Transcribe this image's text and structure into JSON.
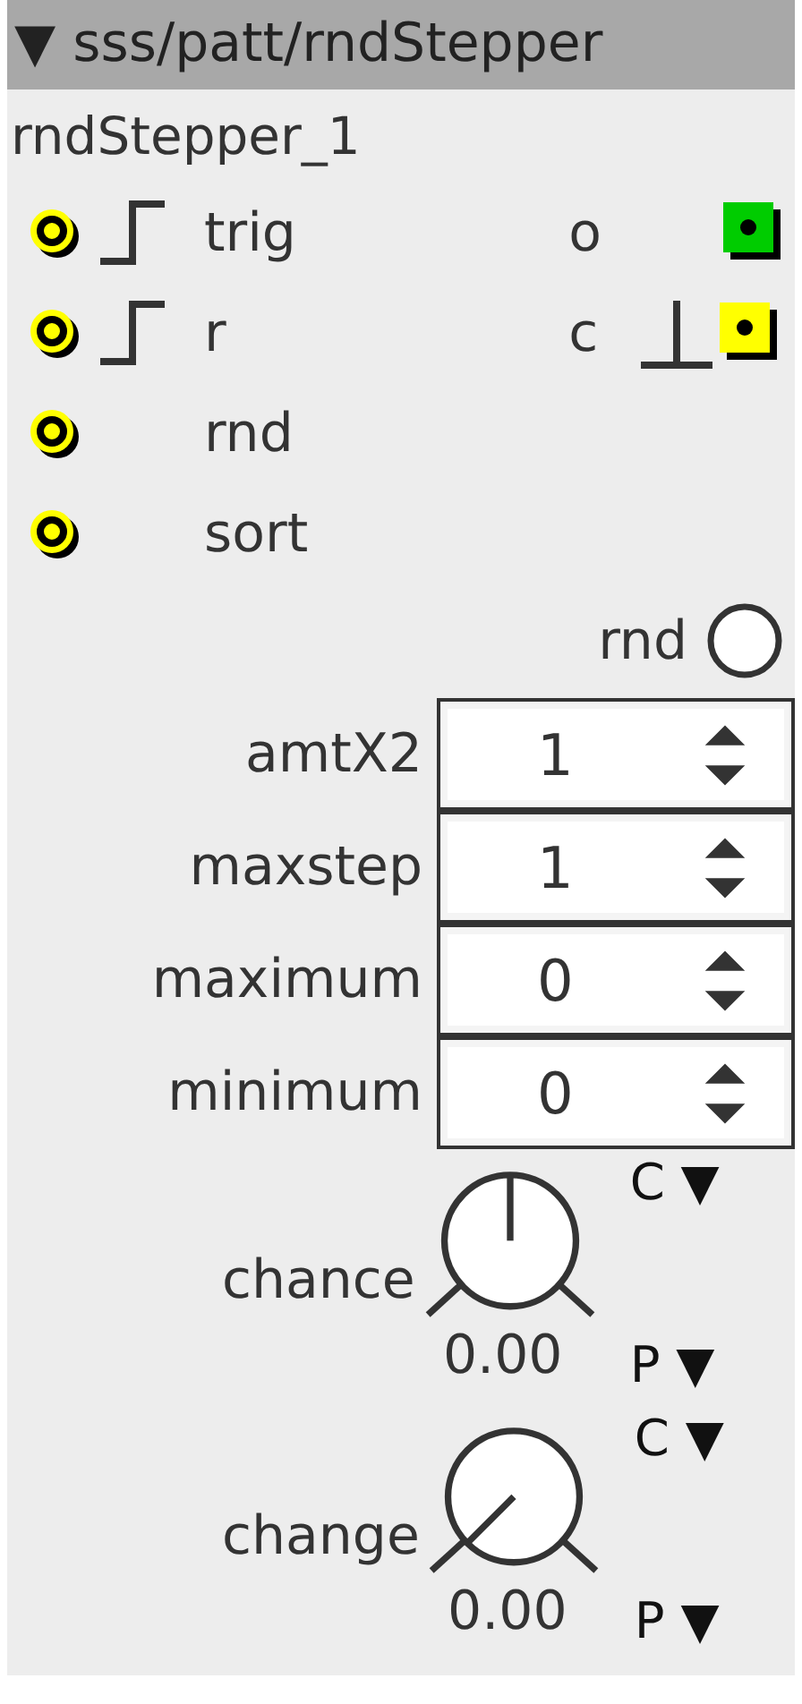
{
  "title": "▼ sss/patt/rndStepper",
  "instance_name": "rndStepper_1",
  "inlets": [
    {
      "label": "trig",
      "kind": "trigger"
    },
    {
      "label": "r",
      "kind": "trigger"
    },
    {
      "label": "rnd",
      "kind": "plain"
    },
    {
      "label": "sort",
      "kind": "plain"
    }
  ],
  "outlets": [
    {
      "label": "o",
      "kind": "plain",
      "color": "#00cc00"
    },
    {
      "label": "c",
      "kind": "pulse",
      "color": "#ffff00"
    }
  ],
  "toggle": {
    "label": "rnd",
    "on": false
  },
  "spinners": [
    {
      "label": "amtX2",
      "value": "1"
    },
    {
      "label": "maxstep",
      "value": "1"
    },
    {
      "label": "maximum",
      "value": "0"
    },
    {
      "label": "minimum",
      "value": "0"
    }
  ],
  "knobs": [
    {
      "label": "chance",
      "reading": "0.00",
      "menu_top": "C ▼",
      "menu_bottom": "P ▼"
    },
    {
      "label": "change",
      "reading": "0.00",
      "menu_top": "C ▼",
      "menu_bottom": "P ▼"
    }
  ]
}
